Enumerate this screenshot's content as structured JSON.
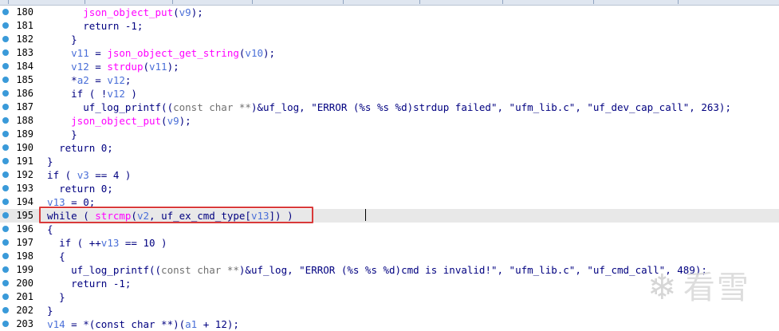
{
  "watermark": {
    "text": "看雪",
    "icon": "snowflake-icon"
  },
  "lines": [
    {
      "n": "180",
      "parts": [
        [
          "",
          "        "
        ],
        [
          "fn",
          "json_object_put"
        ],
        [
          "",
          "("
        ],
        [
          "var",
          "v9"
        ],
        [
          "",
          ");"
        ]
      ]
    },
    {
      "n": "181",
      "parts": [
        [
          "",
          "        return -1;"
        ]
      ]
    },
    {
      "n": "182",
      "parts": [
        [
          "",
          "      }"
        ]
      ]
    },
    {
      "n": "183",
      "parts": [
        [
          "",
          "      "
        ],
        [
          "var",
          "v11"
        ],
        [
          "",
          " = "
        ],
        [
          "fn",
          "json_object_get_string"
        ],
        [
          "",
          "("
        ],
        [
          "var",
          "v10"
        ],
        [
          "",
          ");"
        ]
      ]
    },
    {
      "n": "184",
      "parts": [
        [
          "",
          "      "
        ],
        [
          "var",
          "v12"
        ],
        [
          "",
          " = "
        ],
        [
          "fn",
          "strdup"
        ],
        [
          "",
          "("
        ],
        [
          "var",
          "v11"
        ],
        [
          "",
          ");"
        ]
      ]
    },
    {
      "n": "185",
      "parts": [
        [
          "",
          "      *"
        ],
        [
          "var",
          "a2"
        ],
        [
          "",
          " = "
        ],
        [
          "var",
          "v12"
        ],
        [
          "",
          ";"
        ]
      ]
    },
    {
      "n": "186",
      "parts": [
        [
          "",
          "      if ( !"
        ],
        [
          "var",
          "v12"
        ],
        [
          "",
          " )"
        ]
      ]
    },
    {
      "n": "187",
      "parts": [
        [
          "",
          "        uf_log_printf(("
        ],
        [
          "cast",
          "const char **"
        ],
        [
          "",
          ")&uf_log, \"ERROR (%s %s %d)strdup failed\", \"ufm_lib.c\", \"uf_dev_cap_call\", 263);"
        ]
      ]
    },
    {
      "n": "188",
      "parts": [
        [
          "",
          "      "
        ],
        [
          "fn",
          "json_object_put"
        ],
        [
          "",
          "("
        ],
        [
          "var",
          "v9"
        ],
        [
          "",
          ");"
        ]
      ]
    },
    {
      "n": "189",
      "parts": [
        [
          "",
          "      }"
        ]
      ]
    },
    {
      "n": "190",
      "parts": [
        [
          "",
          "    return 0;"
        ]
      ]
    },
    {
      "n": "191",
      "parts": [
        [
          "",
          "  }"
        ]
      ]
    },
    {
      "n": "192",
      "parts": [
        [
          "",
          "  if ( "
        ],
        [
          "var",
          "v3"
        ],
        [
          "",
          " == 4 )"
        ]
      ]
    },
    {
      "n": "193",
      "parts": [
        [
          "",
          "    return 0;"
        ]
      ]
    },
    {
      "n": "194",
      "parts": [
        [
          "var",
          "  v13"
        ],
        [
          "",
          " = 0;"
        ]
      ]
    },
    {
      "n": "195",
      "parts": [
        [
          "",
          "  while ( "
        ],
        [
          "fn",
          "strcmp"
        ],
        [
          "",
          "("
        ],
        [
          "var",
          "v2"
        ],
        [
          "",
          ", uf_ex_cmd_type["
        ],
        [
          "var",
          "v13"
        ],
        [
          "",
          "]) )"
        ]
      ],
      "current": true
    },
    {
      "n": "196",
      "parts": [
        [
          "",
          "  {"
        ]
      ]
    },
    {
      "n": "197",
      "parts": [
        [
          "",
          "    if ( ++"
        ],
        [
          "var",
          "v13"
        ],
        [
          "",
          " == 10 )"
        ]
      ]
    },
    {
      "n": "198",
      "parts": [
        [
          "",
          "    {"
        ]
      ]
    },
    {
      "n": "199",
      "parts": [
        [
          "",
          "      uf_log_printf(("
        ],
        [
          "cast",
          "const char **"
        ],
        [
          "",
          ")&uf_log, \"ERROR (%s %s %d)cmd is invalid!\", \"ufm_lib.c\", \"uf_cmd_call\", 489);"
        ]
      ]
    },
    {
      "n": "200",
      "parts": [
        [
          "",
          "      return -1;"
        ]
      ]
    },
    {
      "n": "201",
      "parts": [
        [
          "",
          "    }"
        ]
      ]
    },
    {
      "n": "202",
      "parts": [
        [
          "",
          "  }"
        ]
      ]
    },
    {
      "n": "203",
      "parts": [
        [
          "",
          "  "
        ],
        [
          "var",
          "v14"
        ],
        [
          "",
          " = *(const char **)("
        ],
        [
          "var",
          "a1"
        ],
        [
          "",
          " + 12);"
        ]
      ]
    }
  ]
}
